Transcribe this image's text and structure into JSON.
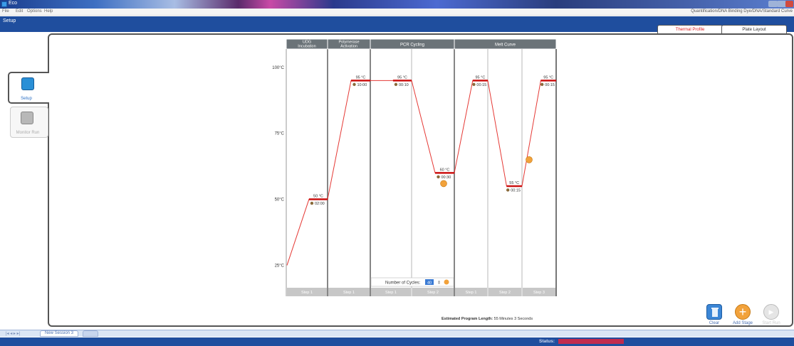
{
  "window": {
    "title": "Eco"
  },
  "menu": {
    "items": [
      "File",
      "Edit",
      "Options",
      "Help"
    ]
  },
  "path_text": "Quantification/DNA Binding Dye/DNA/Standard Curve",
  "section_title": "Setup",
  "tabs": [
    {
      "label": "Thermal Profile",
      "active": true
    },
    {
      "label": "Plate Layout",
      "active": false
    }
  ],
  "sidebar": {
    "items": [
      {
        "label": "Setup",
        "icon": "setup-grid-icon",
        "active": true
      },
      {
        "label": "Monitor Run",
        "icon": "monitor-run-icon",
        "active": false
      }
    ]
  },
  "thermal_profile": {
    "y_axis_labels": [
      "100°C",
      "75°C",
      "50°C",
      "25°C"
    ],
    "stages": [
      "UDG Incubation",
      "Polymerase Activation",
      "PCR Cycling",
      "Melt Curve"
    ],
    "steps": [
      {
        "stage": "UDG Incubation",
        "label": "Step 1",
        "temp_label": "50 °C",
        "time": "02:00",
        "temp": 50
      },
      {
        "stage": "Polymerase Activation",
        "label": "Step 1",
        "temp_label": "95 °C",
        "time": "10:00",
        "temp": 95
      },
      {
        "stage": "PCR Cycling",
        "label": "Step 1",
        "temp_label": "95 °C",
        "time": "00:10",
        "temp": 95
      },
      {
        "stage": "PCR Cycling",
        "label": "Step 2",
        "temp_label": "60 °C",
        "time": "00:30",
        "temp": 60
      },
      {
        "stage": "Melt Curve",
        "label": "Step 1",
        "temp_label": "95 °C",
        "time": "00:15",
        "temp": 95
      },
      {
        "stage": "Melt Curve",
        "label": "Step 2",
        "temp_label": "55 °C",
        "time": "00:15",
        "temp": 55
      },
      {
        "stage": "Melt Curve",
        "label": "Step 3",
        "temp_label": "95 °C",
        "time": "00:15",
        "temp": 95
      }
    ],
    "cycles": {
      "label": "Number of Cycles:",
      "value": "40"
    },
    "colors": {
      "header": "#6b7378",
      "step_footer": "#c7c7c7",
      "line": "#e53935",
      "plateau": "#cc1111",
      "accent": "#f2a23b"
    }
  },
  "estimated": {
    "label": "Estimated Program Length:",
    "value": "55 Minutes 3 Seconds"
  },
  "actions": [
    {
      "label": "Clear",
      "icon": "trash-icon"
    },
    {
      "label": "Add Stage",
      "icon": "plus-icon"
    },
    {
      "label": "Start Run",
      "icon": "play-icon"
    }
  ],
  "session_tab": "New Session 3",
  "status": {
    "label": "Status:"
  }
}
